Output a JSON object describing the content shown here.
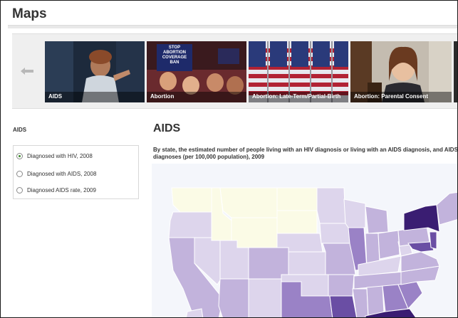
{
  "page": {
    "title": "Maps"
  },
  "carousel": {
    "items": [
      {
        "label": "AIDS"
      },
      {
        "label": "Abortion"
      },
      {
        "label": "Abortion: Late-Term/Partial-Birth"
      },
      {
        "label": "Abortion: Parental Consent"
      }
    ],
    "sign_text": "STOP ABORTION COVERAGE BAN"
  },
  "sidebar": {
    "heading": "AIDS",
    "options": [
      {
        "label": "Diagnosed with HIV, 2008",
        "checked": true
      },
      {
        "label": "Diagnosed with AIDS, 2008",
        "checked": false
      },
      {
        "label": "Diagnosed AIDS rate, 2009",
        "checked": false
      }
    ]
  },
  "main": {
    "title": "AIDS",
    "description": "By state, the estimated number of people living with an HIV diagnosis or living with an AIDS diagnosis, and AIDS diagnoses (per 100,000 population), 2009"
  },
  "colors": {
    "map_lightest": "#fbfbe6",
    "map_light": "#ddd5ec",
    "map_mid": "#c2b3dc",
    "map_strong": "#9a82c6",
    "map_dark": "#6a4ea4",
    "map_darkest": "#3a1d72"
  }
}
